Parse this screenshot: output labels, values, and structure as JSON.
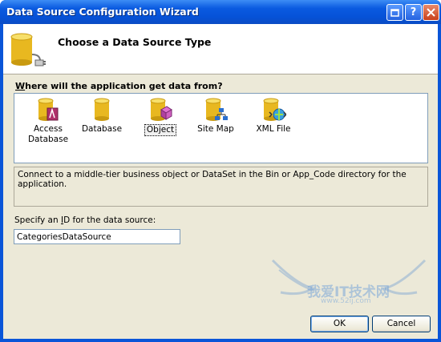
{
  "window": {
    "title": "Data Source Configuration Wizard"
  },
  "header": {
    "title": "Choose a Data Source Type"
  },
  "prompt": {
    "prefix": "",
    "accel": "W",
    "rest": "here will the application get data from?"
  },
  "tiles": [
    {
      "line1": "Access",
      "line2": "Database",
      "icon": "access-database-icon"
    },
    {
      "line1": "Database",
      "line2": "",
      "icon": "database-icon"
    },
    {
      "line1": "Object",
      "line2": "",
      "icon": "object-icon",
      "selected": true
    },
    {
      "line1": "Site Map",
      "line2": "",
      "icon": "site-map-icon"
    },
    {
      "line1": "XML File",
      "line2": "",
      "icon": "xml-file-icon"
    }
  ],
  "description": "Connect to a middle-tier business object or DataSet in the Bin or App_Code directory for the application.",
  "id_field": {
    "label_prefix": "Specify an ",
    "label_accel": "I",
    "label_rest": "D for the data source:",
    "value": "CategoriesDataSource"
  },
  "buttons": {
    "ok": "OK",
    "cancel": "Cancel"
  },
  "watermark": {
    "text": "我爱IT技术网",
    "sub": "www.52ij.com"
  }
}
